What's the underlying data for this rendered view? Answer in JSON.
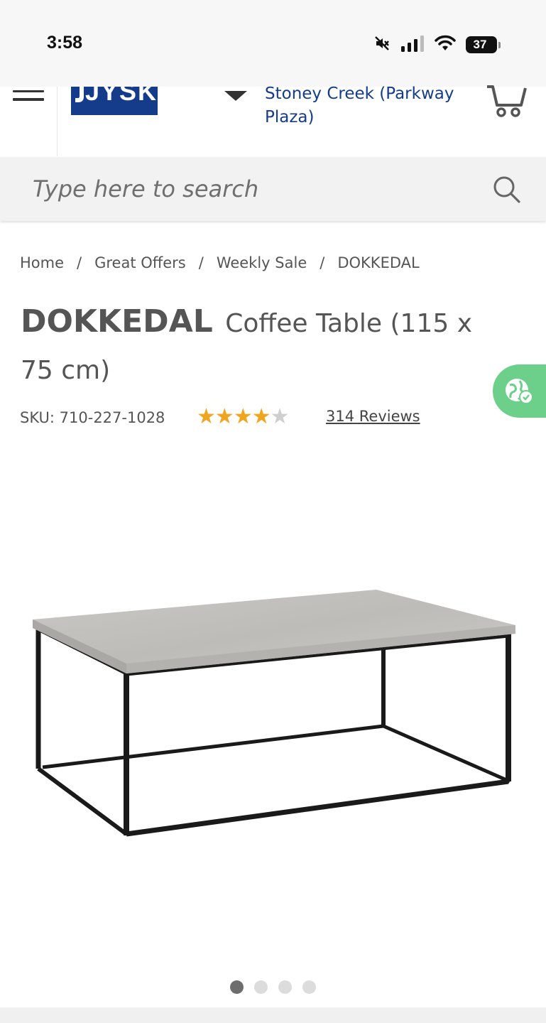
{
  "status_bar": {
    "time": "3:58",
    "battery": "37",
    "icons": [
      "mute-icon",
      "signal-icon",
      "wifi-icon",
      "battery-icon"
    ]
  },
  "header": {
    "logo_text": "JYSK",
    "store_name": "Stoney Creek (Parkway Plaza)",
    "brand_color": "#143c8a"
  },
  "search": {
    "placeholder": "Type here to search"
  },
  "breadcrumb": {
    "items": [
      "Home",
      "Great Offers",
      "Weekly Sale",
      "DOKKEDAL"
    ],
    "separator": "/"
  },
  "product": {
    "brand": "DOKKEDAL",
    "name": "Coffee Table (115 x 75 cm)",
    "sku": "SKU: 710-227-1028",
    "rating": 4,
    "rating_max": 5,
    "reviews_label": "314 Reviews"
  },
  "carousel": {
    "count": 4,
    "active_index": 0
  },
  "colors": {
    "star": "#f0a51f",
    "accessibility_button": "#6ccf8a"
  }
}
